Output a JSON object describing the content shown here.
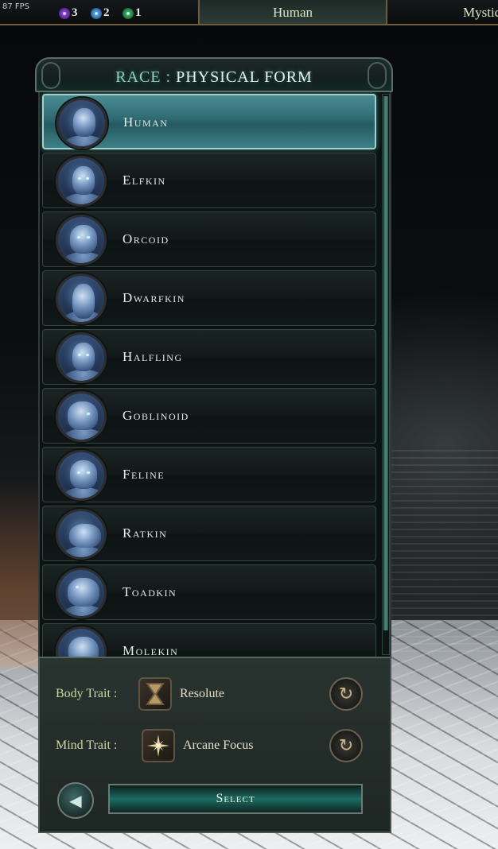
{
  "hud": {
    "fps": "87 FPS",
    "resources": [
      {
        "icon": "eye-icon",
        "value": "3",
        "color": "#8a4fd1"
      },
      {
        "icon": "star-icon",
        "value": "2",
        "color": "#5aa4e6"
      },
      {
        "icon": "leaf-icon",
        "value": "1",
        "color": "#3fae6a"
      }
    ],
    "tabs": {
      "active": "Human",
      "next": "Mystic"
    }
  },
  "panel": {
    "title_prefix": "RACE :",
    "title_main": "PHYSICAL FORM",
    "races": [
      {
        "name": "Human",
        "selected": true
      },
      {
        "name": "Elfkin",
        "selected": false
      },
      {
        "name": "Orcoid",
        "selected": false
      },
      {
        "name": "Dwarfkin",
        "selected": false
      },
      {
        "name": "Halfling",
        "selected": false
      },
      {
        "name": "Goblinoid",
        "selected": false
      },
      {
        "name": "Feline",
        "selected": false
      },
      {
        "name": "Ratkin",
        "selected": false
      },
      {
        "name": "Toadkin",
        "selected": false
      },
      {
        "name": "Molekin",
        "selected": false
      }
    ],
    "body_trait": {
      "label": "Body Trait :",
      "value": "Resolute",
      "icon": "hourglass-icon"
    },
    "mind_trait": {
      "label": "Mind Trait :",
      "value": "Arcane Focus",
      "icon": "starburst-icon"
    },
    "select_label": "Select"
  },
  "colors": {
    "accent": "#8fd0b6",
    "selected_row": "#2f6a72",
    "trait_label": "#c8d8a4"
  }
}
